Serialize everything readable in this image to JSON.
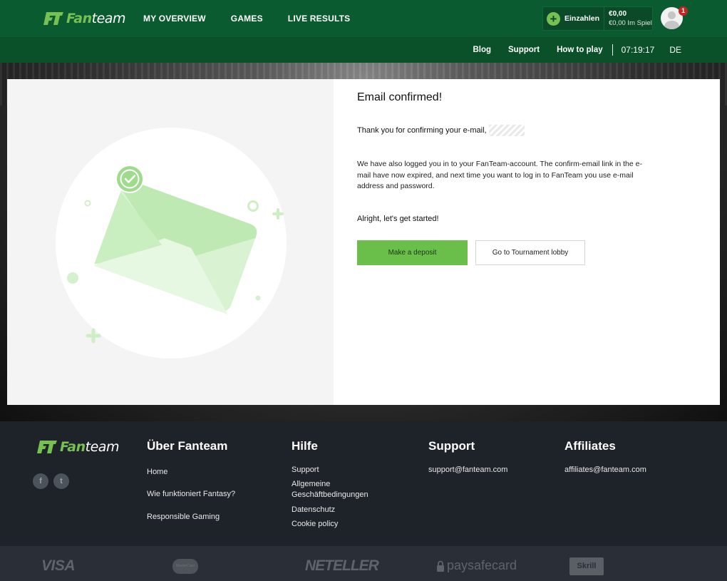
{
  "header": {
    "brand": {
      "fan": "Fan",
      "team": "team"
    },
    "nav": [
      "MY OVERVIEW",
      "GAMES",
      "LIVE RESULTS"
    ],
    "deposit_label": "Einzahlen",
    "balance": "€0,00",
    "in_play": "€0,00 Im Spiel",
    "notification_count": "1"
  },
  "subnav": {
    "links": [
      "Blog",
      "Support",
      "How to play"
    ],
    "time": "07:19:17",
    "language": "DE"
  },
  "confirmation": {
    "title": "Email confirmed!",
    "thanks": "Thank you for confirming your e-mail,",
    "paragraph": "We have also logged you in to your FanTeam-account. The confirm-email link in the e-mail have now expired, and next time you want to log in to FanTeam you use e-mail address and password.",
    "started": "Alright, let's get started!",
    "deposit_button": "Make a deposit",
    "lobby_button": "Go to Tournament lobby"
  },
  "footer": {
    "about": {
      "title": "Über Fanteam",
      "links": [
        "Home",
        "Wie funktioniert Fantasy?",
        "Responsible Gaming"
      ]
    },
    "help": {
      "title": "Hilfe",
      "links": [
        "Support",
        "Allgemeine Geschäftbedingungen",
        "Datenschutz",
        "Cookie policy"
      ]
    },
    "support": {
      "title": "Support",
      "email": "support@fanteam.com"
    },
    "affiliates": {
      "title": "Affiliates",
      "email": "affiliates@fanteam.com"
    },
    "social": [
      "facebook-icon",
      "twitter-icon"
    ]
  },
  "payments": [
    "VISA",
    "MasterCard",
    "NETELLER",
    "paysafecard",
    "Skrill"
  ],
  "colors": {
    "header": "#0b5b31",
    "subbar": "#0a5029",
    "accent": "#6abe4a",
    "footer": "#1e232a"
  }
}
